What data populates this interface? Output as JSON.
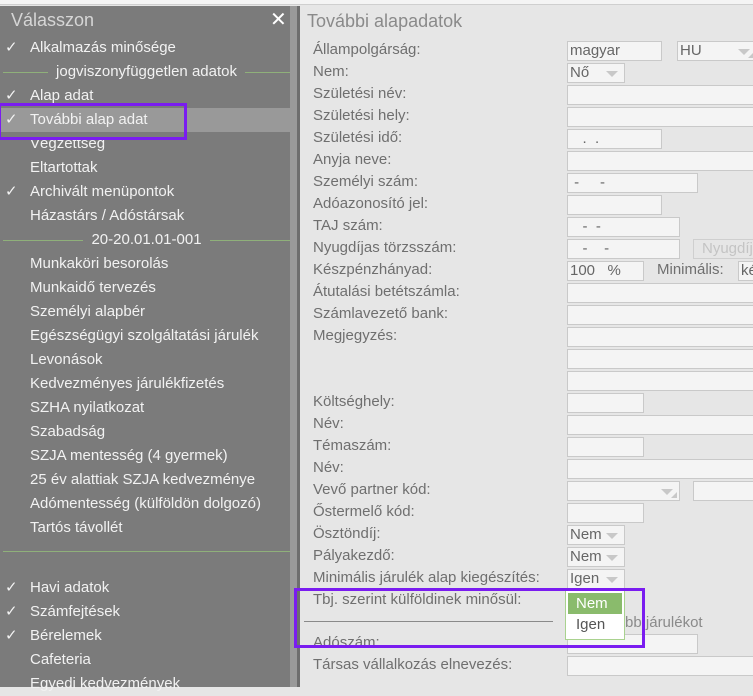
{
  "sidebar": {
    "title": "Válasszon",
    "close_icon": "close-icon",
    "items": [
      {
        "type": "item",
        "label": "Alkalmazás minősége",
        "checked": true
      },
      {
        "type": "sep",
        "label": "jogviszonyfüggetlen adatok"
      },
      {
        "type": "item",
        "label": "Alap adat",
        "checked": true
      },
      {
        "type": "item",
        "label": "További alap adat",
        "checked": true,
        "selected": true
      },
      {
        "type": "item",
        "label": "Végzettség",
        "checked": false
      },
      {
        "type": "item",
        "label": "Eltartottak",
        "checked": false
      },
      {
        "type": "item",
        "label": "Archivált menüpontok",
        "checked": true
      },
      {
        "type": "item",
        "label": "Házastárs / Adóstársak",
        "checked": false
      },
      {
        "type": "sep",
        "label": "20-20.01.01-001"
      },
      {
        "type": "item",
        "label": "Munkaköri besorolás",
        "checked": false
      },
      {
        "type": "item",
        "label": "Munkaidő tervezés",
        "checked": false
      },
      {
        "type": "item",
        "label": "Személyi alapbér",
        "checked": false
      },
      {
        "type": "item",
        "label": "Egészségügyi szolgáltatási járulék",
        "checked": false
      },
      {
        "type": "item",
        "label": "Levonások",
        "checked": false
      },
      {
        "type": "item",
        "label": "Kedvezményes járulékfizetés",
        "checked": false
      },
      {
        "type": "item",
        "label": "SZHA nyilatkozat",
        "checked": false
      },
      {
        "type": "item",
        "label": "Szabadság",
        "checked": false
      },
      {
        "type": "item",
        "label": "SZJA mentesség (4 gyermek)",
        "checked": false
      },
      {
        "type": "item",
        "label": "25 év alattiak SZJA kedvezménye",
        "checked": false
      },
      {
        "type": "item",
        "label": "Adómentesség (külföldön dolgozó)",
        "checked": false
      },
      {
        "type": "item",
        "label": "Tartós távollét",
        "checked": false
      },
      {
        "type": "sep",
        "label": ""
      },
      {
        "type": "item",
        "label": "Havi adatok",
        "checked": true
      },
      {
        "type": "item",
        "label": "Számfejtések",
        "checked": true
      },
      {
        "type": "item",
        "label": "Bérelemek",
        "checked": true
      },
      {
        "type": "item",
        "label": "Cafeteria",
        "checked": false
      },
      {
        "type": "item",
        "label": "Egyedi kedvezmények",
        "checked": false
      }
    ]
  },
  "form": {
    "title": "További alapadatok",
    "rows": [
      {
        "label": "Állampolgárság:",
        "controls": [
          {
            "kind": "input",
            "value": "magyar"
          },
          {
            "kind": "combo",
            "value": "HU"
          }
        ]
      },
      {
        "label": "Nem:",
        "controls": [
          {
            "kind": "select",
            "value": "Nő"
          }
        ]
      },
      {
        "label": "Születési név:",
        "controls": [
          {
            "kind": "input",
            "value": ""
          }
        ]
      },
      {
        "label": "Születési hely:",
        "controls": [
          {
            "kind": "input",
            "value": ""
          }
        ]
      },
      {
        "label": "Születési idő:",
        "controls": [
          {
            "kind": "input",
            "value": "   .  ."
          }
        ]
      },
      {
        "label": "Anyja neve:",
        "controls": [
          {
            "kind": "input",
            "value": ""
          }
        ]
      },
      {
        "label": "Személyi szám:",
        "controls": [
          {
            "kind": "input",
            "value": " -     -"
          }
        ]
      },
      {
        "label": "Adóazonosító jel:",
        "controls": [
          {
            "kind": "input",
            "value": ""
          }
        ]
      },
      {
        "label": "TAJ szám:",
        "controls": [
          {
            "kind": "input",
            "value": "   -  -"
          }
        ]
      },
      {
        "label": "Nyugdíjas törzsszám:",
        "controls": [
          {
            "kind": "input",
            "value": "   -    -"
          },
          {
            "kind": "button",
            "value": "Nyugdíj"
          }
        ]
      },
      {
        "label": "Készpénzhányad:",
        "controls": [
          {
            "kind": "input",
            "value": "100   %"
          },
          {
            "kind": "label",
            "value": "Minimális:"
          },
          {
            "kind": "input",
            "value": "ké"
          }
        ]
      },
      {
        "label": "Átutalási betétszámla:",
        "controls": [
          {
            "kind": "input",
            "value": ""
          }
        ]
      },
      {
        "label": "Számlavezető bank:",
        "controls": [
          {
            "kind": "input",
            "value": ""
          }
        ]
      },
      {
        "label": "Megjegyzés:",
        "controls": [
          {
            "kind": "input",
            "value": ""
          }
        ]
      },
      {
        "label": "",
        "controls": [
          {
            "kind": "input",
            "value": ""
          }
        ]
      },
      {
        "label": "",
        "controls": [
          {
            "kind": "input",
            "value": ""
          }
        ]
      },
      {
        "label": "Költséghely:",
        "controls": [
          {
            "kind": "input",
            "value": ""
          }
        ]
      },
      {
        "label": "Név:",
        "controls": [
          {
            "kind": "input",
            "value": ""
          }
        ]
      },
      {
        "label": "Témaszám:",
        "controls": [
          {
            "kind": "input",
            "value": ""
          }
        ]
      },
      {
        "label": "Név:",
        "controls": [
          {
            "kind": "input",
            "value": ""
          }
        ]
      },
      {
        "label": "Vevő partner kód:",
        "controls": [
          {
            "kind": "combo",
            "value": ""
          },
          {
            "kind": "input",
            "value": ""
          }
        ]
      },
      {
        "label": "Őstermelő kód:",
        "controls": [
          {
            "kind": "input",
            "value": ""
          }
        ]
      },
      {
        "label": "Ösztöndíj:",
        "controls": [
          {
            "kind": "select",
            "value": "Nem"
          }
        ]
      },
      {
        "label": "Pályakezdő:",
        "controls": [
          {
            "kind": "select",
            "value": "Nem"
          }
        ]
      },
      {
        "label": "Minimális járulék alap kiegészítés:",
        "controls": [
          {
            "kind": "select",
            "value": "Igen"
          }
        ]
      },
      {
        "label": "Tbj. szerint külföldinek minősül:",
        "controls": [
          {
            "kind": "select",
            "value": "Nem"
          }
        ]
      }
    ],
    "checkbox_label": "A legkisebb járulékot",
    "rows_after": [
      {
        "label": "Adószám:",
        "controls": [
          {
            "kind": "input",
            "value": ""
          }
        ]
      },
      {
        "label": "Társas vállalkozás elnevezés:",
        "controls": [
          {
            "kind": "input",
            "value": ""
          }
        ]
      }
    ],
    "dropdown": {
      "options": [
        "Nem",
        "Igen"
      ],
      "highlighted": "Nem"
    }
  },
  "colors": {
    "highlight_box": "#7a1cf0",
    "dropdown_highlight": "#8abb6c"
  }
}
